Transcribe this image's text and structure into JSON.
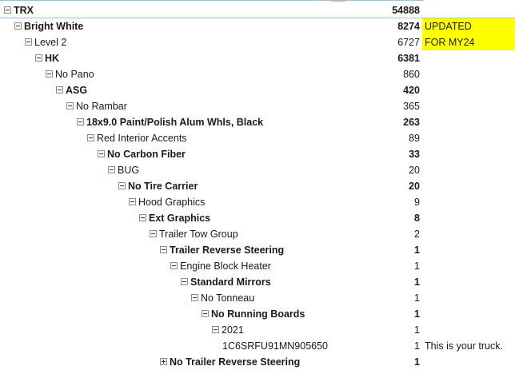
{
  "rows": [
    {
      "label": "TRX",
      "value": "54888",
      "level": 0,
      "bold": true,
      "toggle": "minus",
      "note": "",
      "highlight": false
    },
    {
      "label": "Bright White",
      "value": "8274",
      "level": 1,
      "bold": true,
      "toggle": "minus",
      "note": "UPDATED",
      "highlight": true
    },
    {
      "label": "Level 2",
      "value": "6727",
      "level": 2,
      "bold": false,
      "toggle": "minus",
      "note": "FOR MY24",
      "highlight": true
    },
    {
      "label": "HK",
      "value": "6381",
      "level": 3,
      "bold": true,
      "toggle": "minus",
      "note": "",
      "highlight": false
    },
    {
      "label": "No Pano",
      "value": "860",
      "level": 4,
      "bold": false,
      "toggle": "minus",
      "note": "",
      "highlight": false
    },
    {
      "label": "ASG",
      "value": "420",
      "level": 5,
      "bold": true,
      "toggle": "minus",
      "note": "",
      "highlight": false
    },
    {
      "label": "No Rambar",
      "value": "365",
      "level": 6,
      "bold": false,
      "toggle": "minus",
      "note": "",
      "highlight": false
    },
    {
      "label": "18x9.0 Paint/Polish Alum Whls, Black",
      "value": "263",
      "level": 7,
      "bold": true,
      "toggle": "minus",
      "note": "",
      "highlight": false
    },
    {
      "label": "Red Interior Accents",
      "value": "89",
      "level": 8,
      "bold": false,
      "toggle": "minus",
      "note": "",
      "highlight": false
    },
    {
      "label": "No Carbon Fiber",
      "value": "33",
      "level": 9,
      "bold": true,
      "toggle": "minus",
      "note": "",
      "highlight": false
    },
    {
      "label": "BUG",
      "value": "20",
      "level": 10,
      "bold": false,
      "toggle": "minus",
      "note": "",
      "highlight": false
    },
    {
      "label": "No Tire Carrier",
      "value": "20",
      "level": 11,
      "bold": true,
      "toggle": "minus",
      "note": "",
      "highlight": false
    },
    {
      "label": "Hood Graphics",
      "value": "9",
      "level": 12,
      "bold": false,
      "toggle": "minus",
      "note": "",
      "highlight": false
    },
    {
      "label": "Ext Graphics",
      "value": "8",
      "level": 13,
      "bold": true,
      "toggle": "minus",
      "note": "",
      "highlight": false
    },
    {
      "label": "Trailer Tow Group",
      "value": "2",
      "level": 14,
      "bold": false,
      "toggle": "minus",
      "note": "",
      "highlight": false
    },
    {
      "label": "Trailer Reverse Steering",
      "value": "1",
      "level": 15,
      "bold": true,
      "toggle": "minus",
      "note": "",
      "highlight": false
    },
    {
      "label": "Engine Block Heater",
      "value": "1",
      "level": 16,
      "bold": false,
      "toggle": "minus",
      "note": "",
      "highlight": false
    },
    {
      "label": "Standard Mirrors",
      "value": "1",
      "level": 17,
      "bold": true,
      "toggle": "minus",
      "note": "",
      "highlight": false
    },
    {
      "label": "No Tonneau",
      "value": "1",
      "level": 18,
      "bold": false,
      "toggle": "minus",
      "note": "",
      "highlight": false
    },
    {
      "label": "No Running Boards",
      "value": "1",
      "level": 19,
      "bold": true,
      "toggle": "minus",
      "note": "",
      "highlight": false
    },
    {
      "label": "2021",
      "value": "1",
      "level": 20,
      "bold": false,
      "toggle": "minus",
      "note": "",
      "highlight": false
    },
    {
      "label": "1C6SRFU91MN905650",
      "value": "1",
      "level": 21,
      "bold": false,
      "toggle": "none",
      "note": "This is your truck.",
      "highlight": false
    },
    {
      "label": "No Trailer Reverse Steering",
      "value": "1",
      "level": 15,
      "bold": true,
      "toggle": "plus",
      "note": "",
      "highlight": false
    }
  ]
}
